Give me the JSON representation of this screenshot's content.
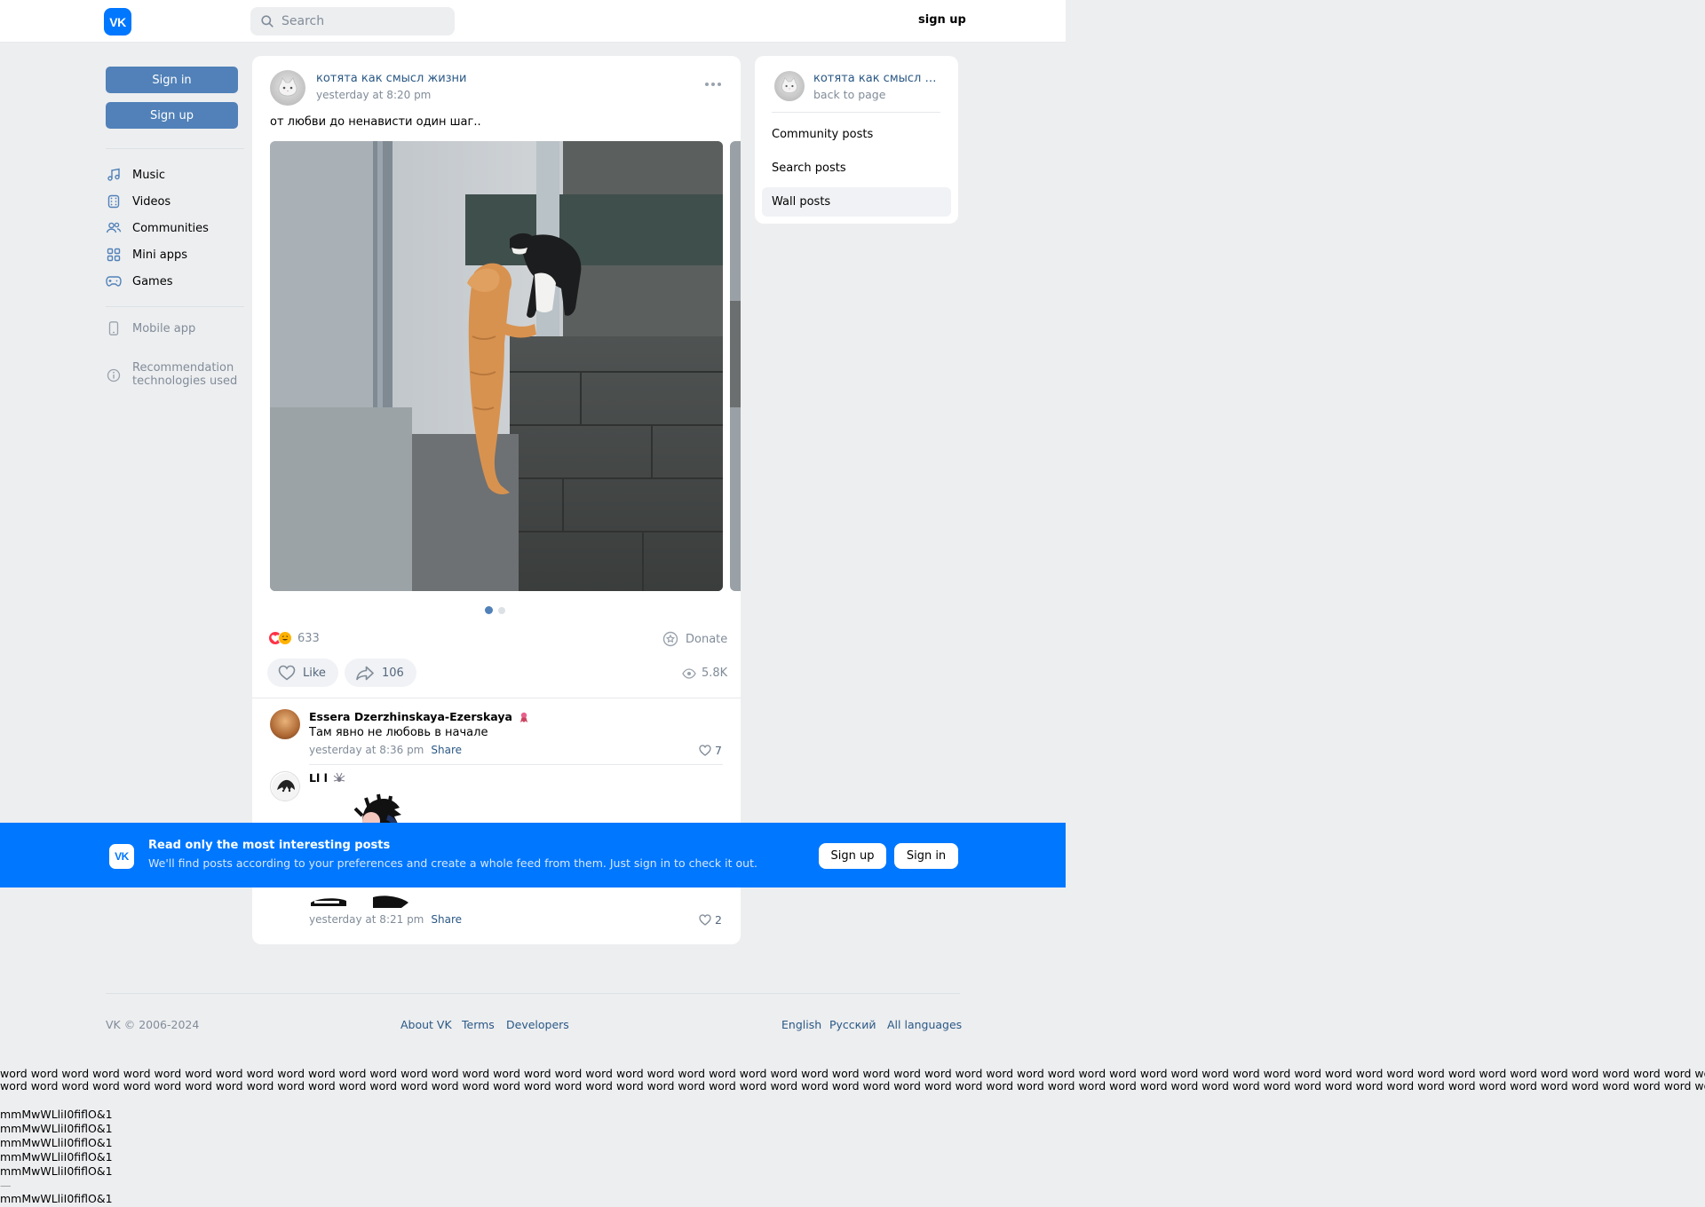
{
  "header": {
    "logo": "VK",
    "search_placeholder": "Search",
    "signup": "sign up"
  },
  "sidebar": {
    "signin": "Sign in",
    "signup": "Sign up",
    "items": [
      {
        "label": "Music",
        "icon": "music-icon"
      },
      {
        "label": "Videos",
        "icon": "video-icon"
      },
      {
        "label": "Communities",
        "icon": "users-icon"
      },
      {
        "label": "Mini apps",
        "icon": "grid-icon"
      },
      {
        "label": "Games",
        "icon": "gamepad-icon"
      }
    ],
    "mobile_app": "Mobile app",
    "rec_line1": "Recommendation",
    "rec_line2": "technologies used"
  },
  "post": {
    "author": "котята как смысл жизни",
    "time": "yesterday at 8:20 pm",
    "text": "от любви до ненависти один шаг..",
    "reactions_count": "633",
    "donate": "Donate",
    "like": "Like",
    "share_count": "106",
    "views": "5.8K",
    "carousel_index": 0,
    "carousel_total": 2
  },
  "comments": [
    {
      "author": "Essera Dzerzhinskaya-Ezerskaya",
      "text": "Там явно не любовь в начале",
      "time": "yesterday at 8:36 pm",
      "share": "Share",
      "likes": "7"
    },
    {
      "author": "Ll l",
      "time": "yesterday at 8:21 pm",
      "share": "Share",
      "likes": "2"
    }
  ],
  "rightcard": {
    "title": "котята как смысл жизни",
    "back": "back to page",
    "items": [
      "Community posts",
      "Search posts",
      "Wall posts"
    ],
    "selected": "Wall posts"
  },
  "banner": {
    "logo": "VK",
    "title": "Read only the most interesting posts",
    "subtitle": "We'll find posts according to your preferences and create a whole feed from them. Just sign in to check it out.",
    "signup": "Sign up",
    "signin": "Sign in"
  },
  "footer": {
    "copyright": "VK © 2006-2024",
    "about": "About VK",
    "terms": "Terms",
    "developers": "Developers",
    "english": "English",
    "russian": "Русский",
    "all_languages": "All languages"
  },
  "test_strings": {
    "words_line1": "word word word word word word word word word word word word word word word word word word word word word word word word word word word word word word word word word word word word word word word word word word word word word word word word word word word word word word word word word word word word word",
    "words_line2": "word word word word word word word word word word word word word word word word word word word word word word word word word word word word word word word word word word word word word word word word word word word word word word word word word word word word word word word word word word word word word",
    "glyphs": "mmMwWLliI0fiflO&1",
    "dash": "—"
  },
  "colors": {
    "accent": "#0077ff",
    "button": "#5181b8",
    "link": "#2a5885",
    "muted": "#818c99",
    "background": "#edeef0"
  }
}
